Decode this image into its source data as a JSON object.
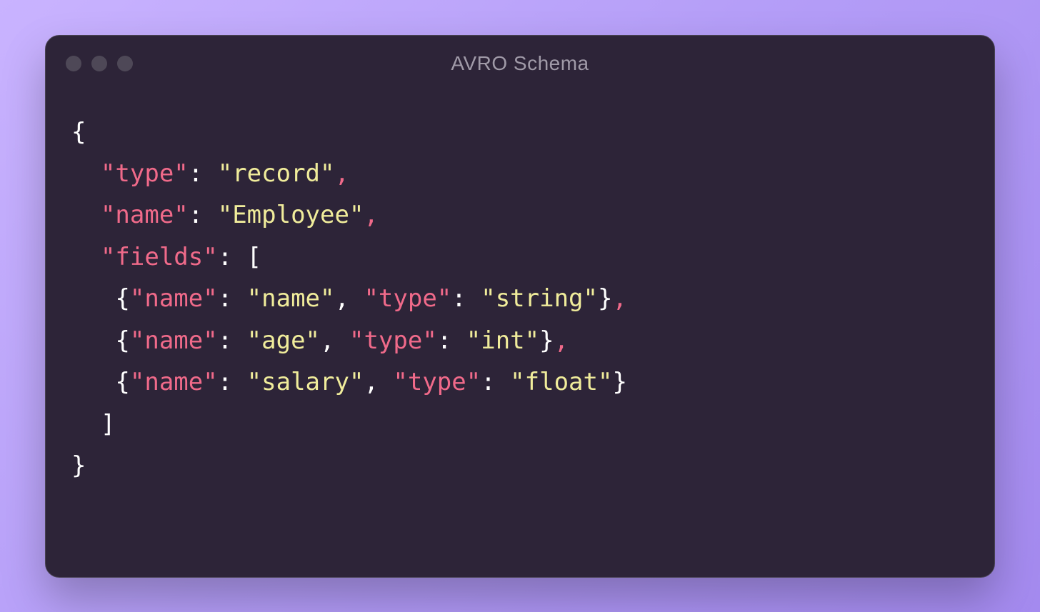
{
  "window": {
    "title": "AVRO Schema"
  },
  "code": {
    "line1_open": "{",
    "line2_key": "\"type\"",
    "line2_colon": ": ",
    "line2_val": "\"record\"",
    "line2_comma": ",",
    "line3_key": "\"name\"",
    "line3_colon": ": ",
    "line3_val": "\"Employee\"",
    "line3_comma": ",",
    "line4_key": "\"fields\"",
    "line4_colon": ": ",
    "line4_bracket": "[",
    "f1_openbrace": "{",
    "f1_name_key": "\"name\"",
    "f1_colon1": ": ",
    "f1_name_val": "\"name\"",
    "f1_sep1": ", ",
    "f1_type_key": "\"type\"",
    "f1_colon2": ": ",
    "f1_type_val": "\"string\"",
    "f1_closebrace": "}",
    "f1_trailcomma": ",",
    "f2_openbrace": "{",
    "f2_name_key": "\"name\"",
    "f2_colon1": ": ",
    "f2_name_val": "\"age\"",
    "f2_sep1": ", ",
    "f2_type_key": "\"type\"",
    "f2_colon2": ": ",
    "f2_type_val": "\"int\"",
    "f2_closebrace": "}",
    "f2_trailcomma": ",",
    "f3_openbrace": "{",
    "f3_name_key": "\"name\"",
    "f3_colon1": ": ",
    "f3_name_val": "\"salary\"",
    "f3_sep1": ", ",
    "f3_type_key": "\"type\"",
    "f3_colon2": ": ",
    "f3_type_val": "\"float\"",
    "f3_closebrace": "}",
    "line_close_bracket": "]",
    "line_close_brace": "}"
  }
}
